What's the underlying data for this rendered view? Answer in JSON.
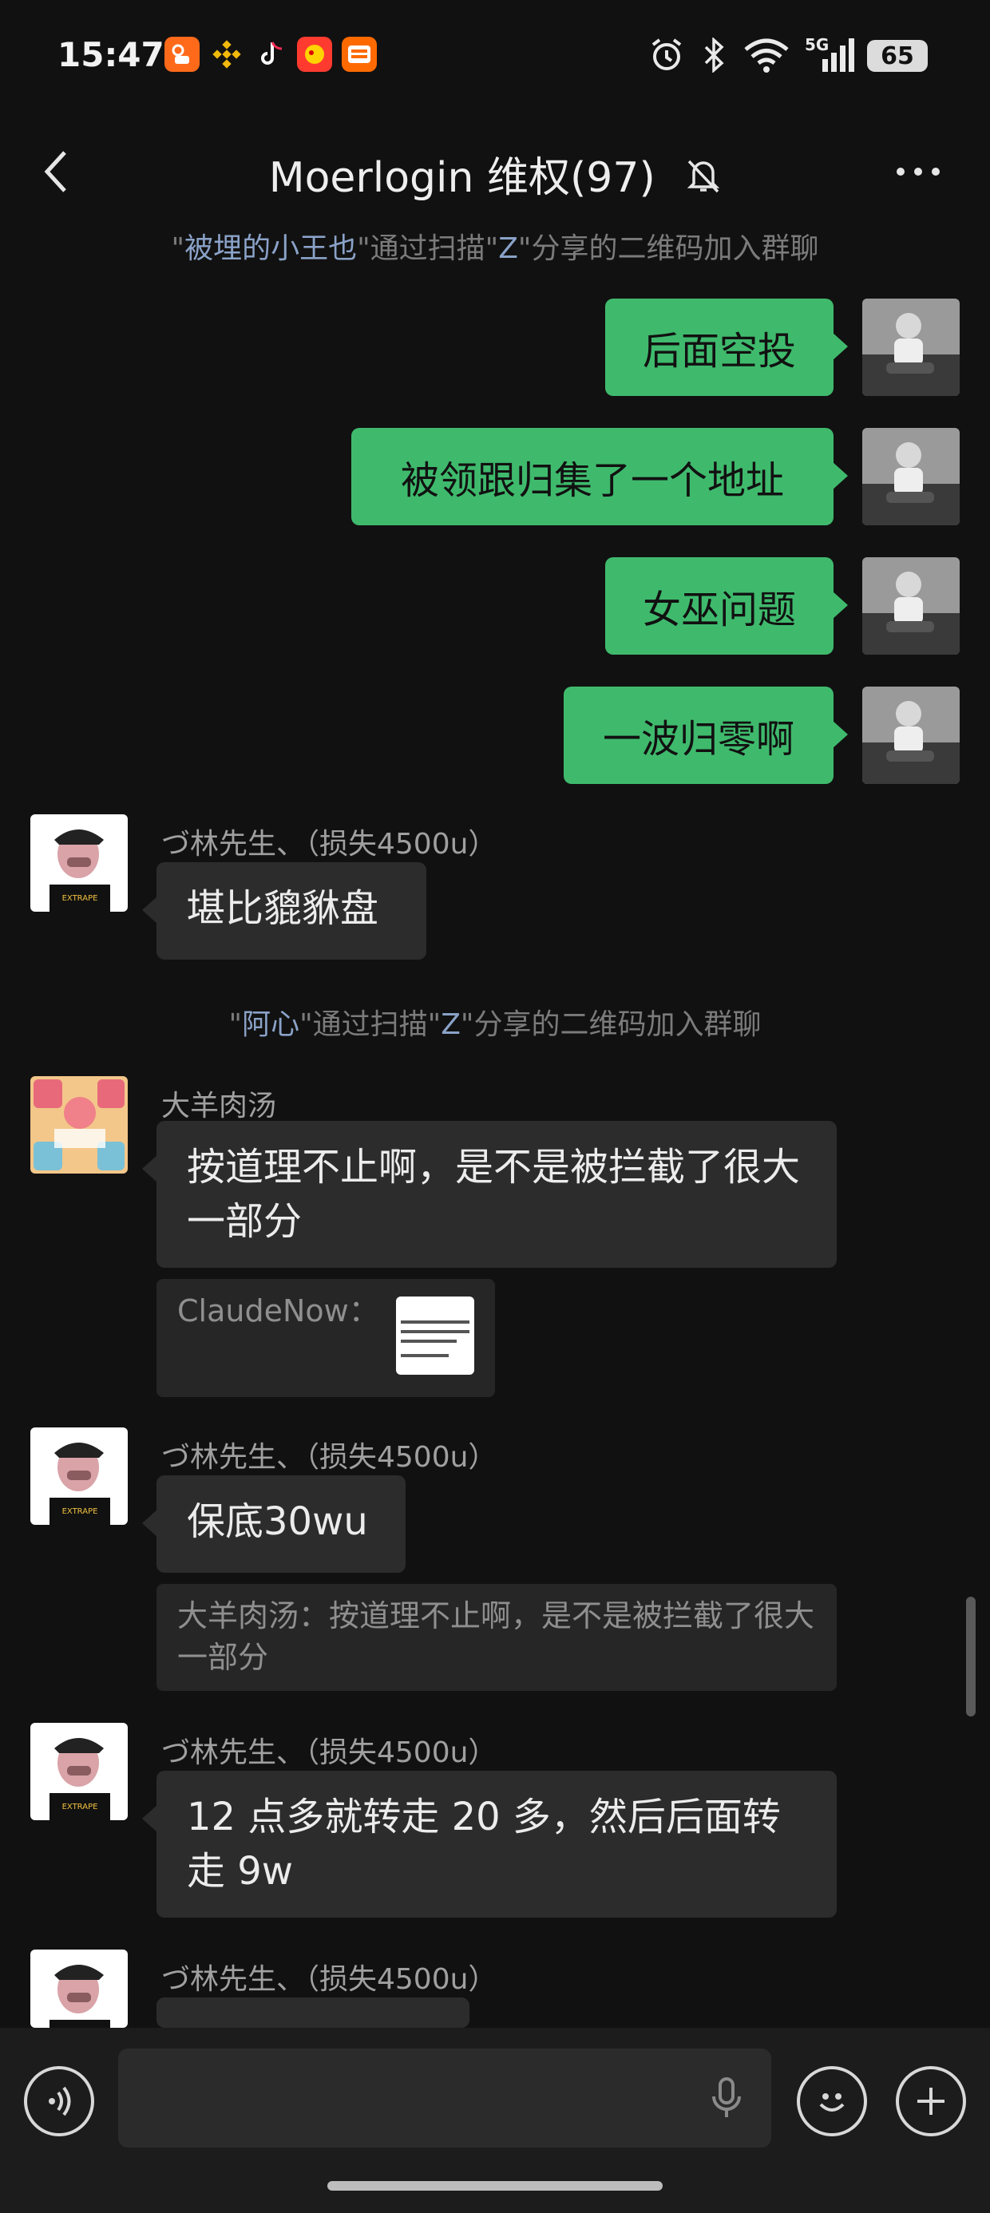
{
  "status_bar": {
    "time": "15:47",
    "apps": [
      "kuaishou-icon",
      "binance-icon",
      "tiktok-icon",
      "red-app-icon",
      "taobao-icon"
    ],
    "network": "5G",
    "battery": "65"
  },
  "header": {
    "title": "Moerlogin 维权(97)",
    "icons": [
      "back-arrow-icon",
      "mute-bell-icon",
      "more-dots-icon"
    ]
  },
  "notices": [
    {
      "q1": "\"",
      "name": "被埋的小王也",
      "q2": "\"通过扫描\"",
      "by": "Z",
      "tail": "\"分享的二维码加入群聊"
    },
    {
      "q1": "\"",
      "name": "阿心",
      "q2": "\"通过扫描\"",
      "by": "Z",
      "tail": "\"分享的二维码加入群聊"
    }
  ],
  "outgoing": [
    {
      "text": "后面空投"
    },
    {
      "text": "被领跟归集了一个地址"
    },
    {
      "text": "女巫问题"
    },
    {
      "text": "一波归零啊"
    }
  ],
  "incoming": [
    {
      "sender": "づ林先生、（损失4500u）",
      "text": "堪比貔貅盘"
    },
    {
      "sender": "大羊肉汤",
      "text": "按道理不止啊，是不是被拦截了很大一部分"
    },
    {
      "sender": "づ林先生、（损失4500u）",
      "text": "保底30wu"
    },
    {
      "sender": "づ林先生、（损失4500u）",
      "text": "12 点多就转走 20 多，然后后面转走 9w"
    },
    {
      "sender": "づ林先生、（损失4500u）"
    }
  ],
  "quotes": [
    {
      "text": "ClaudeNow："
    },
    {
      "text": "大羊肉汤：按道理不止啊，是不是被拦截了很大一部分"
    }
  ],
  "input_bar": {
    "icons": [
      "voice-icon",
      "mic-icon",
      "emoji-icon",
      "plus-icon"
    ]
  },
  "colors": {
    "background": "#111111",
    "outgoing_bubble": "#3fba6d",
    "incoming_bubble": "#2c2c2c",
    "notice_name": "#8aa2c8"
  }
}
